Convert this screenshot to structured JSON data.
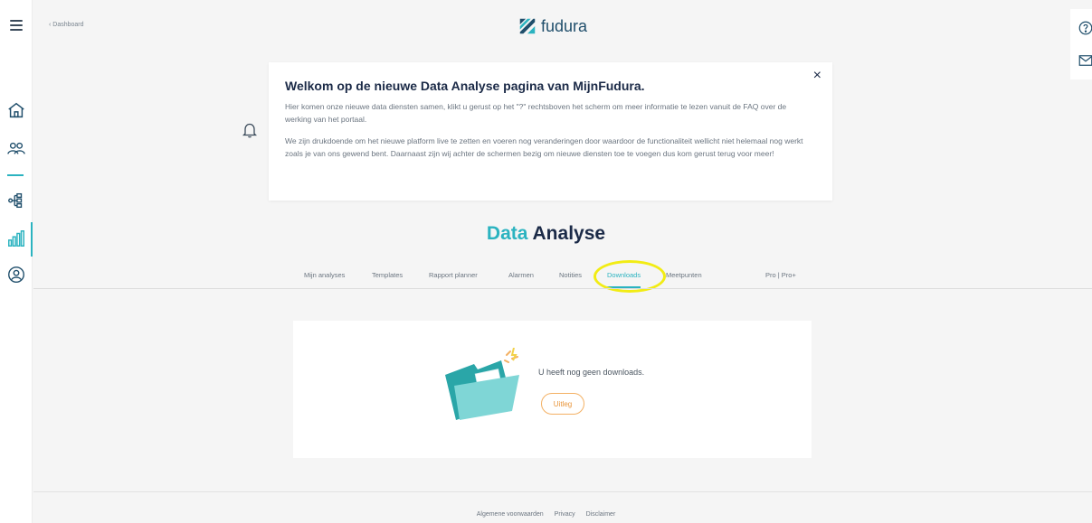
{
  "header": {
    "back_label": "‹  Dashboard",
    "logo_text": "fudura"
  },
  "welcome": {
    "title": "Welkom op de nieuwe Data Analyse pagina van MijnFudura.",
    "paragraph1": "Hier komen onze nieuwe data diensten samen, klikt u gerust op het \"?\" rechtsboven het scherm om meer informatie te lezen vanuit de FAQ over de werking van het portaal.",
    "paragraph2": "We zijn drukdoende om het nieuwe platform live te zetten en voeren nog veranderingen door waardoor de functionaliteit wellicht niet helemaal nog werkt zoals je van ons gewend bent. Daarnaast zijn wij achter de schermen bezig om nieuwe diensten toe te voegen dus kom gerust terug voor meer!",
    "close_label": "×"
  },
  "page": {
    "title_part1": "Data",
    "title_part2": "Analyse"
  },
  "tabs": [
    {
      "label": "Mijn analyses"
    },
    {
      "label": "Templates"
    },
    {
      "label": "Rapport planner"
    },
    {
      "label": "Alarmen"
    },
    {
      "label": "Notities"
    },
    {
      "label": "Downloads",
      "active": true
    },
    {
      "label": "Meetpunten"
    },
    {
      "label": "Pro | Pro+"
    }
  ],
  "empty_state": {
    "message": "U heeft nog geen downloads.",
    "button_label": "Uitleg"
  },
  "footer": {
    "links": [
      "Algemene voorwaarden",
      "Privacy",
      "Disclaimer"
    ]
  },
  "colors": {
    "accent": "#2bb3c0",
    "navy": "#1b2a47",
    "orange": "#f3b063",
    "highlight": "#f2ec14"
  },
  "icons": {
    "left_rail": [
      "menu-icon",
      "home-icon",
      "group-icon",
      "hierarchy-icon",
      "bar-chart-icon",
      "user-circle-icon"
    ],
    "right_rail": [
      "help-icon",
      "mail-icon"
    ],
    "notification": "bell-icon"
  }
}
